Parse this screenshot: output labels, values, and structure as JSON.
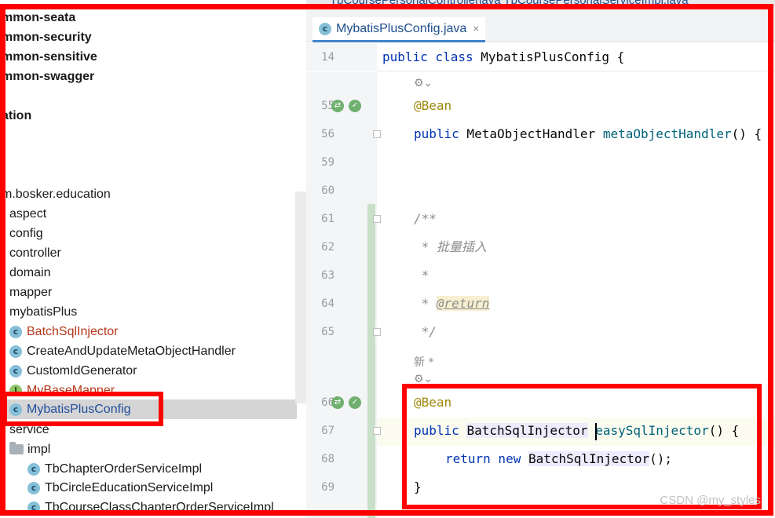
{
  "editor_tab": {
    "label": "MybatisPlusConfig.java",
    "close": "×"
  },
  "top_strip_text": "TbCoursePersonalControllerjava   TbCoursePersonalServiceImpl.java",
  "tree": {
    "modules": [
      "mmon-seata",
      "mmon-security",
      "mmon-sensitive",
      "mmon-swagger",
      "ation"
    ],
    "package": "m.bosker.education",
    "folders": [
      "aspect",
      "config",
      "controller",
      "domain",
      "mapper",
      "mybatisPlus"
    ],
    "mybatisPlus_children": [
      {
        "label": "BatchSqlInjector",
        "icon": "class-icon"
      },
      {
        "label": "CreateAndUpdateMetaObjectHandler",
        "icon": "class-icon"
      },
      {
        "label": "CustomIdGenerator",
        "icon": "class-icon"
      },
      {
        "label": "MyBaseMapper",
        "icon": "interface-icon"
      },
      {
        "label": "MybatisPlusConfig",
        "icon": "class-icon",
        "selected": true
      }
    ],
    "service": "service",
    "impl": "impl",
    "impl_children": [
      "TbChapterOrderServiceImpl",
      "TbCircleEducationServiceImpl",
      "TbCourseClassChapterOrderServiceImpl"
    ],
    "icon_letter_class": "c",
    "icon_letter_interface": "I"
  },
  "code": {
    "sticky": {
      "line": "14",
      "kw": "public class",
      "rest": " MybatisPlusConfig {"
    },
    "lines": {
      "l55": "55",
      "l56": "56",
      "l59": "59",
      "l60": "60",
      "l61": "61",
      "l62": "62",
      "l63": "63",
      "l64": "64",
      "l65": "65",
      "l66": "66",
      "l67": "67",
      "l68": "68",
      "l69": "69"
    },
    "bean": "@Bean",
    "public": "public",
    "meta_type": " MetaObjectHandler ",
    "meta_method": "metaObjectHandler",
    "meta_rest": "() {",
    "doc_open": "/**",
    "doc_star": " * ",
    "doc_text": "批量插入",
    "doc_return_tag": "@return",
    "doc_close": " */",
    "new_hint": "新 *",
    "usage_hint": "⚙︎⌄",
    "batch_type": "BatchSqlInjector",
    "batch_method": "easySqlInjector",
    "batch_rest": "() {",
    "return_kw": "return new",
    "return_type": "BatchSqlInjector",
    "return_rest": "();",
    "close_brace": "}"
  },
  "watermark": "CSDN @my_styles",
  "colors": {
    "annotation_frame": "#ff0000",
    "selection": "#d5d5d5",
    "keyword": "#0033b3"
  }
}
